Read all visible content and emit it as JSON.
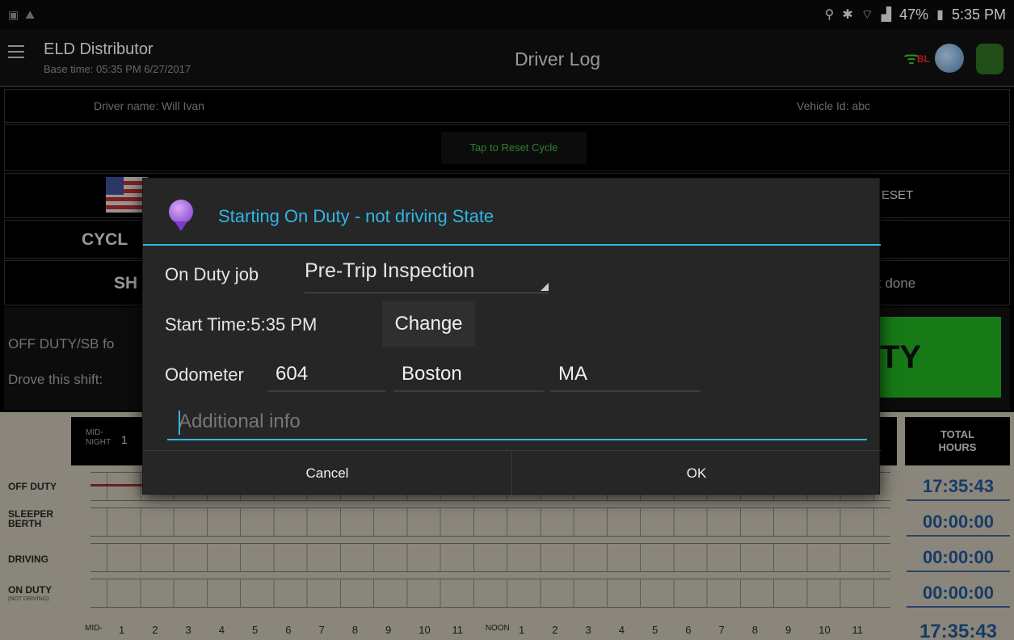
{
  "status_bar": {
    "battery": "47%",
    "time": "5:35 PM"
  },
  "app": {
    "title": "ELD Distributor",
    "base_time": "Base time: 05:35 PM 6/27/2017",
    "page_title": "Driver Log",
    "bl_label": "BL"
  },
  "driver_row": {
    "driver_name": "Driver name: Will Ivan",
    "vehicle_id": "Vehicle Id: abc"
  },
  "reset_cycle": "Tap to Reset Cycle",
  "background_labels": {
    "reset_partial": "ESET",
    "cycle_partial": "CYCL",
    "shift_partial": "SH",
    "done_partial": "t done",
    "off_duty_partial": "OFF DUTY/SB fo",
    "drove_partial": "Drove this shift:",
    "duty_partial": "TY"
  },
  "graph": {
    "mid_night": "MID-\nNIGHT",
    "first_hour": "1",
    "total_header": "TOTAL\nHOURS",
    "rows": [
      {
        "label": "OFF DUTY",
        "sub": "",
        "total": "17:35:43"
      },
      {
        "label": "SLEEPER BERTH",
        "sub": "",
        "total": "00:00:00"
      },
      {
        "label": "DRIVING",
        "sub": "",
        "total": "00:00:00"
      },
      {
        "label": "ON DUTY",
        "sub": "(NOT DRIVING)",
        "total": "00:00:00"
      }
    ],
    "axis_hours": [
      "MID-",
      "1",
      "2",
      "3",
      "4",
      "5",
      "6",
      "7",
      "8",
      "9",
      "10",
      "11",
      "NOON",
      "1",
      "2",
      "3",
      "4",
      "5",
      "6",
      "7",
      "8",
      "9",
      "10",
      "11"
    ],
    "grand_total": "17:35:43"
  },
  "dialog": {
    "title": "Starting On Duty - not driving State",
    "on_duty_job_label": "On Duty job",
    "on_duty_job_value": "Pre-Trip Inspection",
    "start_time_label": "Start Time:5:35 PM",
    "change_label": "Change",
    "odometer_label": "Odometer",
    "odometer_value": "604",
    "city_value": "Boston",
    "state_value": "MA",
    "info_placeholder": "Additional info",
    "cancel_label": "Cancel",
    "ok_label": "OK"
  },
  "colors": {
    "accent": "#33b5e5",
    "status_green": "#1fa31f",
    "totals_blue": "#1e4f8a"
  }
}
